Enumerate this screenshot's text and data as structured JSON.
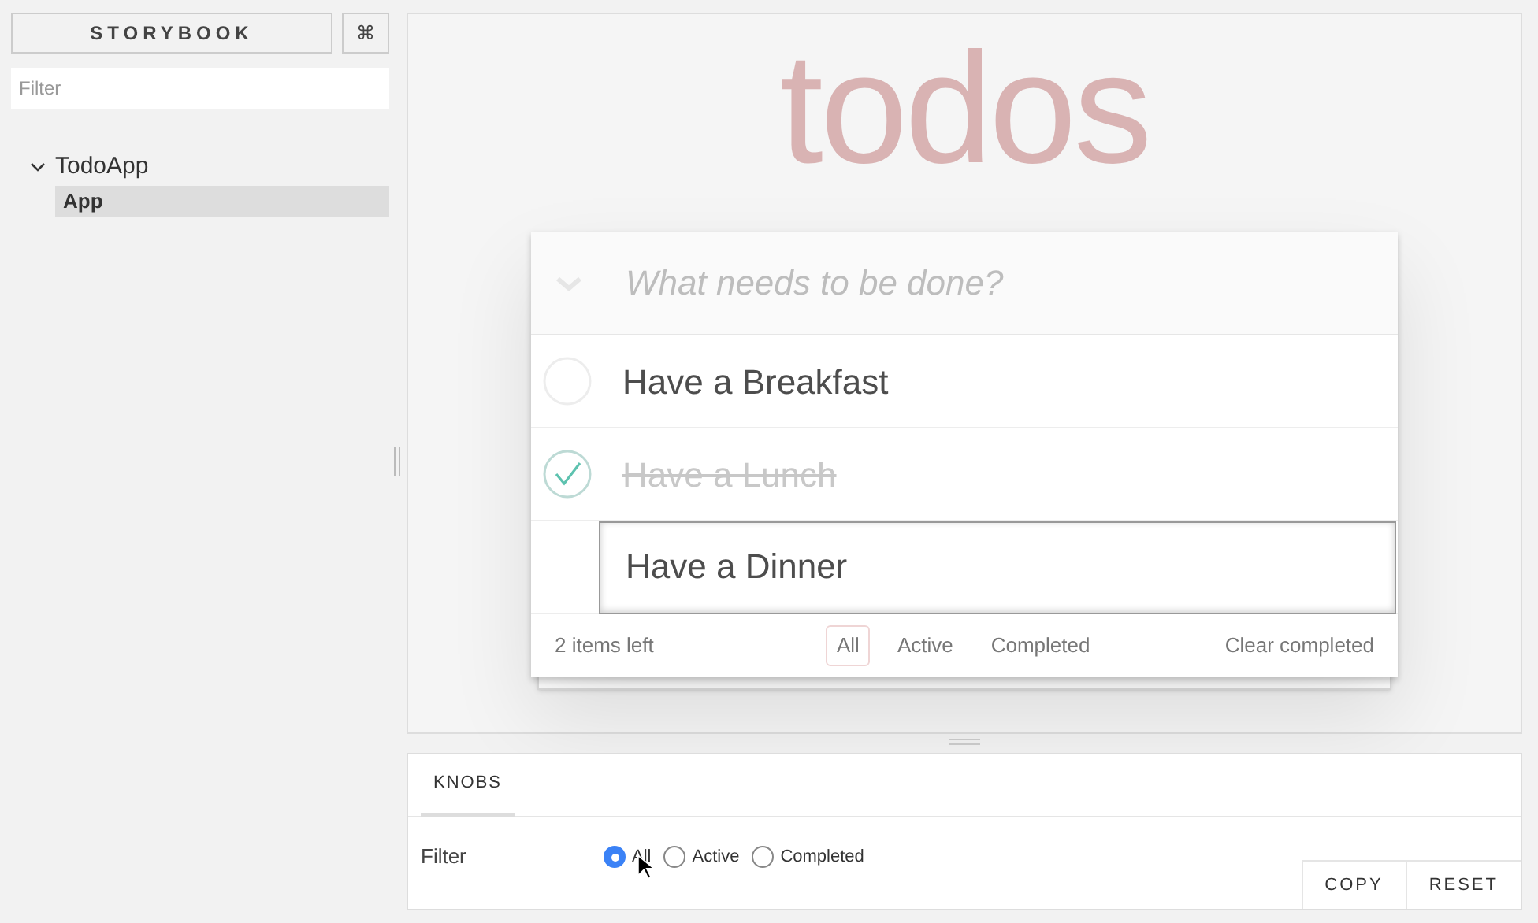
{
  "sidebar": {
    "brand": "STORYBOOK",
    "shortcut_button": "⌘",
    "filter": {
      "placeholder": "Filter"
    },
    "tree": [
      {
        "label": "TodoApp",
        "expanded": true,
        "children": [
          {
            "label": "App",
            "selected": true
          }
        ]
      }
    ]
  },
  "preview": {
    "title": "todos",
    "new_todo": {
      "placeholder": "What needs to be done?"
    },
    "todos": [
      {
        "text": "Have a Breakfast",
        "completed": false,
        "editing": false
      },
      {
        "text": "Have a Lunch",
        "completed": true,
        "editing": false
      },
      {
        "text": "Have a Dinner",
        "editing": true
      }
    ],
    "count": "2 items left",
    "filters": [
      {
        "label": "All",
        "selected": true
      },
      {
        "label": "Active",
        "selected": false
      },
      {
        "label": "Completed",
        "selected": false
      }
    ],
    "clear": "Clear completed"
  },
  "addons": {
    "tabs": [
      {
        "label": "KNOBS",
        "selected": true
      }
    ],
    "knob": {
      "label": "Filter",
      "options": [
        {
          "label": "All",
          "selected": true
        },
        {
          "label": "Active",
          "selected": false
        },
        {
          "label": "Completed",
          "selected": false
        }
      ]
    },
    "buttons": [
      "COPY",
      "RESET"
    ]
  }
}
